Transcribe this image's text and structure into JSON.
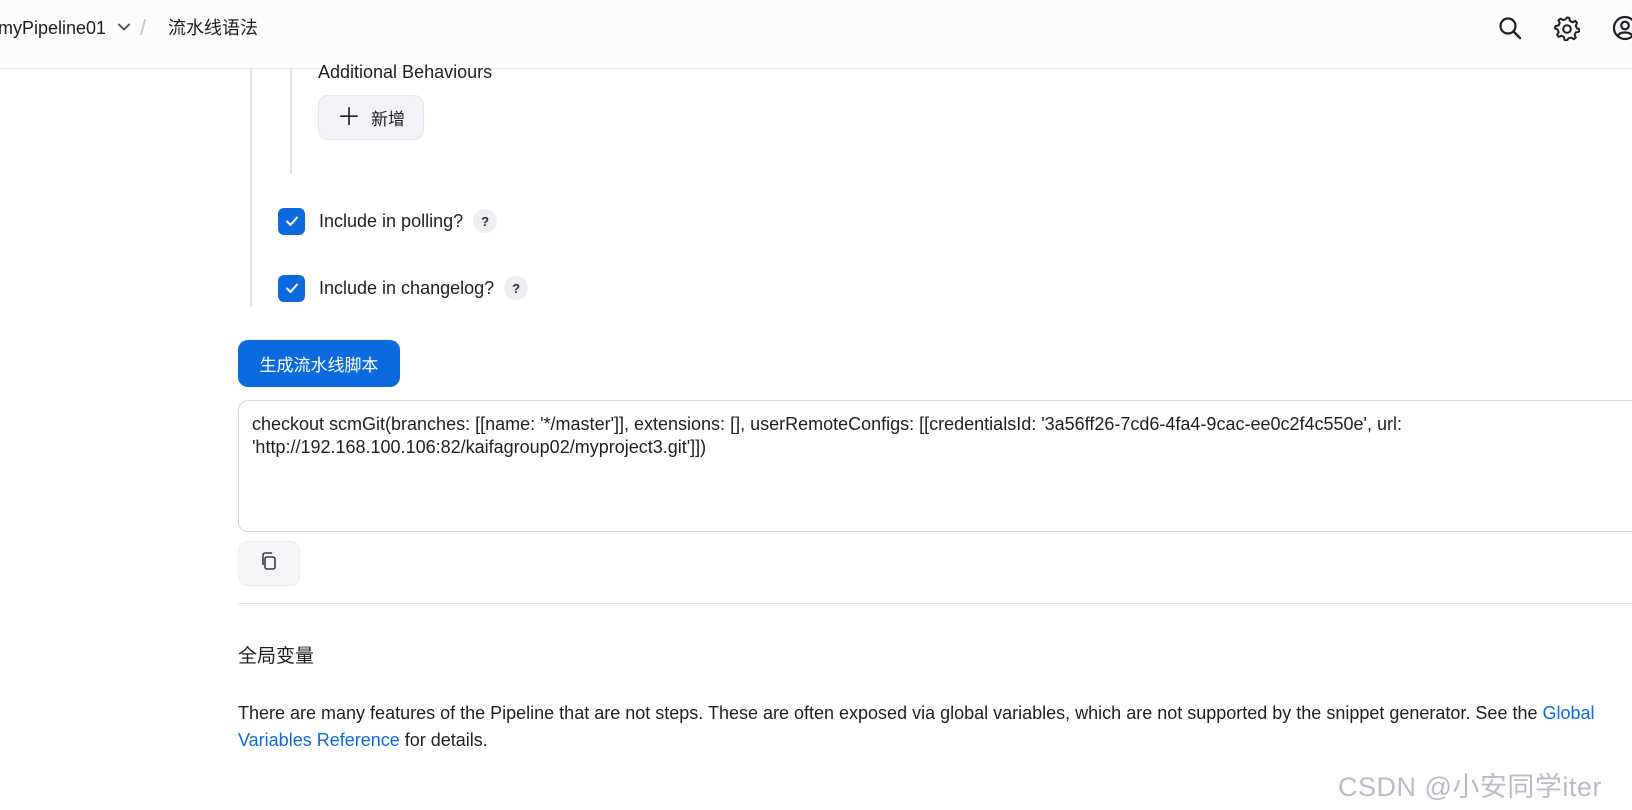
{
  "header": {
    "job_name": "myPipeline01",
    "separator": "/",
    "page_title": "流水线语法",
    "icons": [
      "search-icon",
      "gear-icon",
      "user-icon"
    ]
  },
  "config": {
    "additional_behaviours_label": "Additional Behaviours",
    "add_button_label": "新增",
    "add_button_icon": "plus-icon",
    "include_polling": {
      "label": "Include in polling?",
      "checked": true,
      "help": "?"
    },
    "include_changelog": {
      "label": "Include in changelog?",
      "checked": true,
      "help": "?"
    }
  },
  "generator": {
    "generate_button_label": "生成流水线脚本",
    "script": "checkout scmGit(branches: [[name: '*/master']], extensions: [], userRemoteConfigs: [[credentialsId: '3a56ff26-7cd6-4fa4-9cac-ee0c2f4c550e', url: 'http://192.168.100.106:82/kaifagroup02/myproject3.git']])",
    "copy_icon": "copy-icon"
  },
  "global_variables": {
    "title": "全局变量",
    "description_before": "There are many features of the Pipeline that are not steps. These are often exposed via global variables, which are not supported by the snippet generator. See the ",
    "link_text": "Global Variables Reference",
    "description_after": " for details."
  },
  "watermark": "CSDN @小安同学iter",
  "colors": {
    "accent": "#0b6bde",
    "text": "#1e1e24",
    "border": "#d5d7de"
  }
}
